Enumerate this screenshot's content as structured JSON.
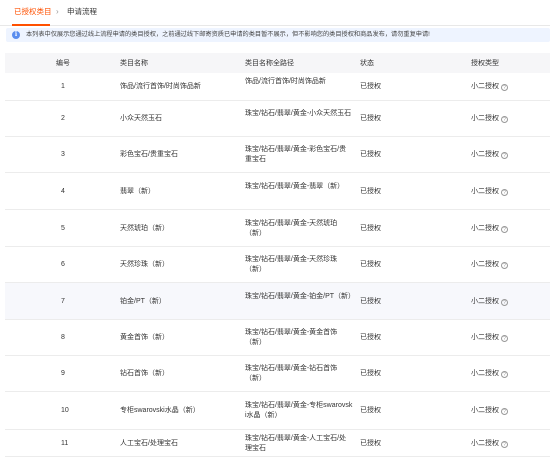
{
  "tabs": {
    "authorized_label": "已授权类目",
    "separator": "›",
    "apply_label": "申请流程"
  },
  "notice": {
    "icon": "info-icon",
    "text": "本列表中仅展示您通过线上流程申请的类目授权，之前通过线下邮寄资质已申请的类目暂不展示，但不影响您的类目授权和商品发布，请勿重复申请!"
  },
  "table": {
    "headers": [
      "编号",
      "类目名称",
      "类目名称全路径",
      "状态",
      "授权类型"
    ],
    "rows": [
      {
        "num": "1",
        "name": "饰品/流行首饰/时尚饰品新",
        "path": "饰品/流行首饰/时尚饰品新",
        "status": "已授权",
        "type": "小二授权"
      },
      {
        "num": "2",
        "name": "小众天然玉石",
        "path": "珠宝/钻石/翡翠/黄金-小众天然玉石",
        "status": "已授权",
        "type": "小二授权"
      },
      {
        "num": "3",
        "name": "彩色宝石/贵重宝石",
        "path": "珠宝/钻石/翡翠/黄金-彩色宝石/贵重宝石",
        "status": "已授权",
        "type": "小二授权"
      },
      {
        "num": "4",
        "name": "翡翠（新）",
        "path": "珠宝/钻石/翡翠/黄金-翡翠（新）",
        "status": "已授权",
        "type": "小二授权"
      },
      {
        "num": "5",
        "name": "天然琥珀（新）",
        "path": "珠宝/钻石/翡翠/黄金-天然琥珀（新）",
        "status": "已授权",
        "type": "小二授权"
      },
      {
        "num": "6",
        "name": "天然珍珠（新）",
        "path": "珠宝/钻石/翡翠/黄金-天然珍珠（新）",
        "status": "已授权",
        "type": "小二授权"
      },
      {
        "num": "7",
        "name": "铂金/PT（新）",
        "path": "珠宝/钻石/翡翠/黄金-铂金/PT（新）",
        "status": "已授权",
        "type": "小二授权"
      },
      {
        "num": "8",
        "name": "黄金首饰（新）",
        "path": "珠宝/钻石/翡翠/黄金-黄金首饰（新）",
        "status": "已授权",
        "type": "小二授权"
      },
      {
        "num": "9",
        "name": "钻石首饰（新）",
        "path": "珠宝/钻石/翡翠/黄金-钻石首饰（新）",
        "status": "已授权",
        "type": "小二授权"
      },
      {
        "num": "10",
        "name": "专柜swarovski水晶（新）",
        "path": "珠宝/钻石/翡翠/黄金-专柜swarovski水晶（新）",
        "status": "已授权",
        "type": "小二授权"
      },
      {
        "num": "11",
        "name": "人工宝石/处理宝石",
        "path": "珠宝/钻石/翡翠/黄金-人工宝石/处理宝石",
        "status": "已授权",
        "type": "小二授权"
      }
    ]
  },
  "colors": {
    "accent": "#ff5000",
    "notice_bg": "#eef4ff",
    "header_bg": "#f6f6f8",
    "alt_row_bg": "#f7f8fc"
  }
}
